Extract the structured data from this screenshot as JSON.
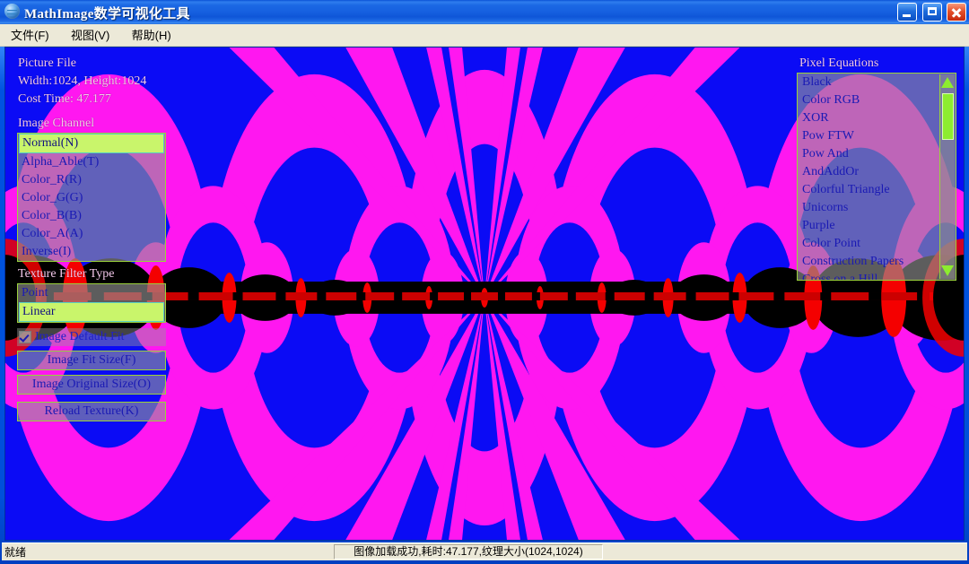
{
  "window": {
    "title": "MathImage数学可视化工具",
    "icon": "globe-icon",
    "controls": {
      "minimize": "minimize-button",
      "maximize": "maximize-button",
      "close": "close-button"
    }
  },
  "menubar": {
    "items": [
      {
        "label": "文件(F)"
      },
      {
        "label": "视图(V)"
      },
      {
        "label": "帮助(H)"
      }
    ]
  },
  "overlay_left": {
    "picture_file_label": "Picture File",
    "dimensions": "Width:1024, Height:1024",
    "cost_time": "Cost Time: 47.177",
    "image_channel_label": "Image Channel",
    "image_channel_items": [
      {
        "label": "Normal(N)",
        "selected": true
      },
      {
        "label": "Alpha_Able(T)",
        "selected": false
      },
      {
        "label": "Color_R(R)",
        "selected": false
      },
      {
        "label": "Color_G(G)",
        "selected": false
      },
      {
        "label": "Color_B(B)",
        "selected": false
      },
      {
        "label": "Color_A(A)",
        "selected": false
      },
      {
        "label": "Inverse(I)",
        "selected": false
      }
    ],
    "texture_filter_label": "Texture Filter Type",
    "texture_filter_items": [
      {
        "label": "Point",
        "selected": false
      },
      {
        "label": "Linear",
        "selected": true
      }
    ],
    "default_fit_checkbox": {
      "label": "Image Default Fit",
      "checked": true
    },
    "buttons": [
      {
        "label": "Image Fit Size(F)"
      },
      {
        "label": "Image Original Size(O)"
      },
      {
        "label": "Reload Texture(K)"
      }
    ]
  },
  "overlay_right": {
    "pixel_equations_label": "Pixel Equations",
    "items": [
      {
        "label": "Black"
      },
      {
        "label": "Color RGB"
      },
      {
        "label": "XOR"
      },
      {
        "label": "Pow FTW"
      },
      {
        "label": "Pow And"
      },
      {
        "label": "AndAddOr"
      },
      {
        "label": "Colorful Triangle"
      },
      {
        "label": "Unicorns"
      },
      {
        "label": "Purple"
      },
      {
        "label": "Color Point"
      },
      {
        "label": "Construction Papers"
      },
      {
        "label": "Cross on a Hill"
      }
    ]
  },
  "statusbar": {
    "left_text": "就绪",
    "panel_text": "图像加载成功,耗时:47.177,纹理大小(1024,1024)"
  },
  "colors": {
    "canvas_blue": "#0b0bf5",
    "canvas_magenta": "#ff17f0",
    "canvas_red": "#f40000",
    "canvas_black": "#000000",
    "selection_green": "#c9f56b",
    "hud_label_pink": "#f1c6e8",
    "hud_text_blue": "#1a1ab4",
    "titlebar_blue": "#1660e0",
    "chrome_beige": "#ece9d8"
  }
}
